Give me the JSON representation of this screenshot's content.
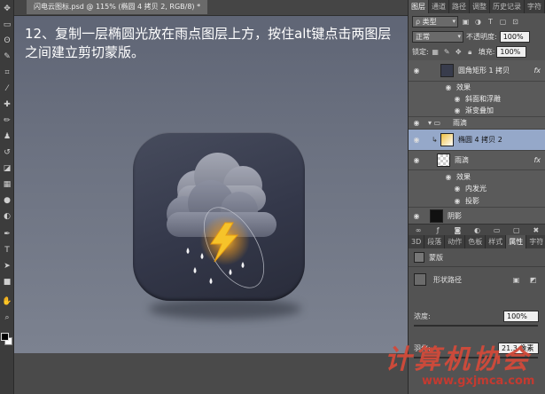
{
  "document": {
    "tab_title": "闪电云图标.psd @ 115% (椭圆 4 拷贝 2, RGB/8) *",
    "caption": "12、复制一层椭圆光放在雨点图层上方，按住alt键点击两图层之间建立剪切蒙版。"
  },
  "tools": [
    "move-tool-icon",
    "marquee-tool-icon",
    "lasso-tool-icon",
    "quick-select-icon",
    "crop-tool-icon",
    "eyedropper-icon",
    "heal-brush-icon",
    "brush-tool-icon",
    "clone-stamp-icon",
    "history-brush-icon",
    "eraser-icon",
    "gradient-tool-icon",
    "blur-tool-icon",
    "dodge-tool-icon",
    "pen-tool-icon",
    "type-tool-icon",
    "path-select-icon",
    "shape-tool-icon",
    "hand-tool-icon",
    "zoom-tool-icon"
  ],
  "layers_panel": {
    "tabs": [
      "图层",
      "通道",
      "路径",
      "调整",
      "历史记录",
      "字符"
    ],
    "filter_label": "类型",
    "blend_mode": "正常",
    "opacity_label": "不透明度:",
    "opacity_value": "100%",
    "lock_label": "锁定:",
    "fill_label": "填充:",
    "fill_value": "100%",
    "layers": [
      {
        "name": "圆角矩形 1 拷贝",
        "has_fx": true
      },
      {
        "name": "效果"
      },
      {
        "name": "斜面和浮雕"
      },
      {
        "name": "渐变叠加"
      },
      {
        "name": "雨滴"
      },
      {
        "name": "椭圆 4 拷贝 2",
        "selected": true
      },
      {
        "name": "雨滴",
        "has_fx": true
      },
      {
        "name": "效果"
      },
      {
        "name": "内发光"
      },
      {
        "name": "投影"
      },
      {
        "name": "阴影"
      }
    ],
    "fx_symbol": "fx"
  },
  "properties_panel": {
    "tabs": [
      "3D",
      "段落",
      "动作",
      "色板",
      "样式",
      "属性",
      "字符",
      "字形"
    ],
    "title": "蒙版",
    "shape_path_label": "形状路径",
    "density_label": "浓度:",
    "density_value": "100%",
    "feather_label": "羽化:",
    "feather_value": "21.3 像素"
  },
  "watermark": {
    "text": "计算机协会",
    "url": "www.gxjmca.com"
  },
  "colors": {
    "selection": "#95a8c9",
    "bolt": "#f6c32a",
    "watermark": "#d24a3a"
  }
}
